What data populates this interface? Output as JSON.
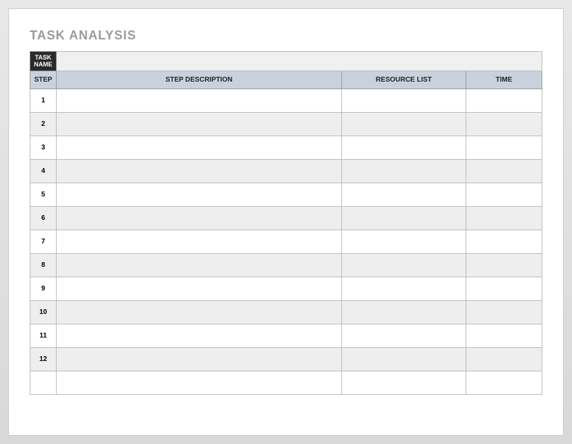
{
  "title": "TASK ANALYSIS",
  "task_name_header": "TASK\nNAME",
  "columns": {
    "step": "STEP",
    "description": "STEP DESCRIPTION",
    "resource": "RESOURCE LIST",
    "time": "TIME"
  },
  "rows": [
    {
      "step": "1",
      "description": "",
      "resource": "",
      "time": ""
    },
    {
      "step": "2",
      "description": "",
      "resource": "",
      "time": ""
    },
    {
      "step": "3",
      "description": "",
      "resource": "",
      "time": ""
    },
    {
      "step": "4",
      "description": "",
      "resource": "",
      "time": ""
    },
    {
      "step": "5",
      "description": "",
      "resource": "",
      "time": ""
    },
    {
      "step": "6",
      "description": "",
      "resource": "",
      "time": ""
    },
    {
      "step": "7",
      "description": "",
      "resource": "",
      "time": ""
    },
    {
      "step": "8",
      "description": "",
      "resource": "",
      "time": ""
    },
    {
      "step": "9",
      "description": "",
      "resource": "",
      "time": ""
    },
    {
      "step": "10",
      "description": "",
      "resource": "",
      "time": ""
    },
    {
      "step": "11",
      "description": "",
      "resource": "",
      "time": ""
    },
    {
      "step": "12",
      "description": "",
      "resource": "",
      "time": ""
    }
  ]
}
